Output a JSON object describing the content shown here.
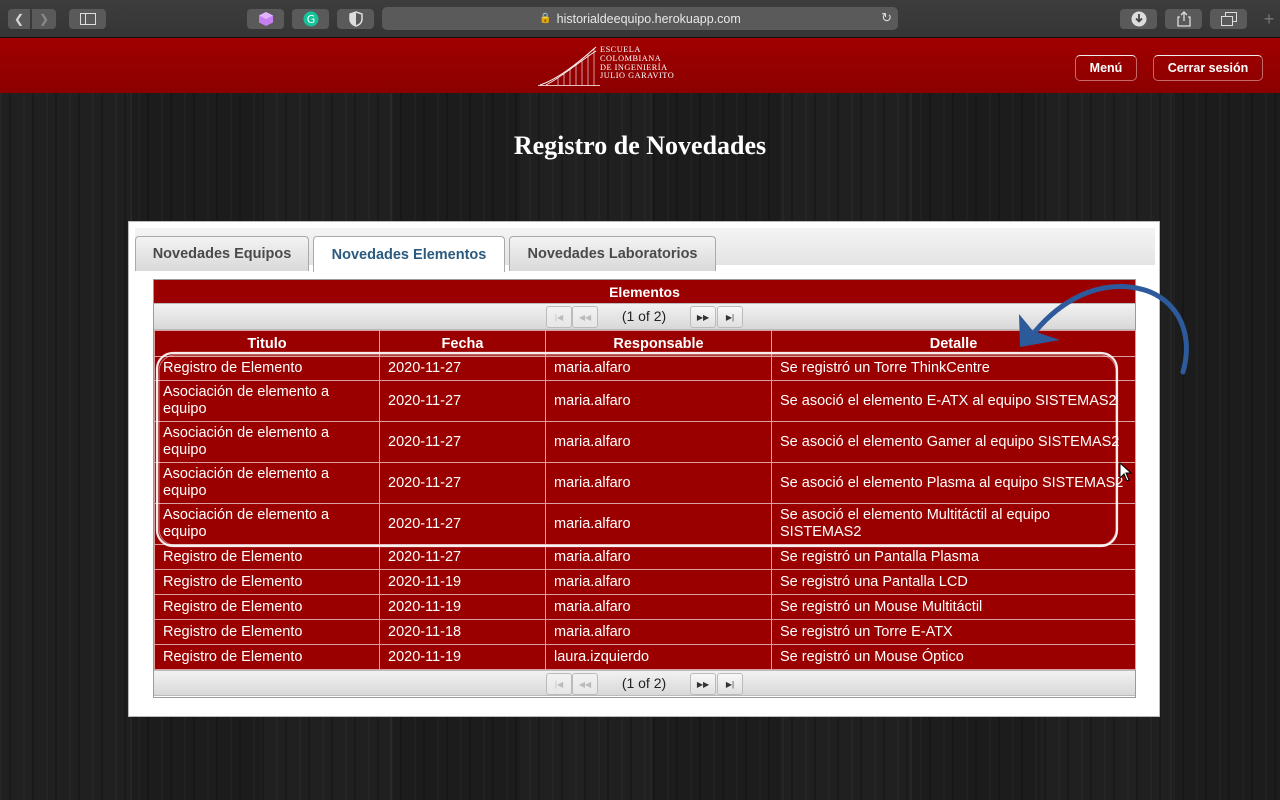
{
  "browser": {
    "url": "historialdeequipo.herokuapp.com"
  },
  "header": {
    "logo_lines": [
      "ESCUELA",
      "COLOMBIANA",
      "DE INGENIERÍA",
      "JULIO GARAVITO"
    ],
    "menu_label": "Menú",
    "logout_label": "Cerrar sesión"
  },
  "page": {
    "title": "Registro de Novedades"
  },
  "tabs": [
    {
      "label": "Novedades Equipos",
      "active": false
    },
    {
      "label": "Novedades Elementos",
      "active": true
    },
    {
      "label": "Novedades Laboratorios",
      "active": false
    }
  ],
  "table": {
    "caption": "Elementos",
    "page_status": "(1 of 2)",
    "columns": [
      "Titulo",
      "Fecha",
      "Responsable",
      "Detalle"
    ],
    "rows": [
      [
        "Registro de Elemento",
        "2020-11-27",
        "maria.alfaro",
        "Se registró un Torre ThinkCentre"
      ],
      [
        "Asociación de elemento a equipo",
        "2020-11-27",
        "maria.alfaro",
        "Se asoció el elemento E-ATX al equipo SISTEMAS2"
      ],
      [
        "Asociación de elemento a equipo",
        "2020-11-27",
        "maria.alfaro",
        "Se asoció el elemento Gamer al equipo SISTEMAS2"
      ],
      [
        "Asociación de elemento a equipo",
        "2020-11-27",
        "maria.alfaro",
        "Se asoció el elemento Plasma al equipo SISTEMAS2"
      ],
      [
        "Asociación de elemento a equipo",
        "2020-11-27",
        "maria.alfaro",
        "Se asoció el elemento Multitáctil al equipo SISTEMAS2"
      ],
      [
        "Registro de Elemento",
        "2020-11-27",
        "maria.alfaro",
        "Se registró un Pantalla Plasma"
      ],
      [
        "Registro de Elemento",
        "2020-11-19",
        "maria.alfaro",
        "Se registró una Pantalla LCD"
      ],
      [
        "Registro de Elemento",
        "2020-11-19",
        "maria.alfaro",
        "Se registró un Mouse Multitáctil"
      ],
      [
        "Registro de Elemento",
        "2020-11-18",
        "maria.alfaro",
        "Se registró un Torre E-ATX"
      ],
      [
        "Registro de Elemento",
        "2020-11-19",
        "laura.izquierdo",
        "Se registró un Mouse Óptico"
      ]
    ]
  },
  "colors": {
    "header_red": "#9b0000",
    "annotation_arrow": "#2d5a9a",
    "tab_active_text": "#2a5a80"
  }
}
